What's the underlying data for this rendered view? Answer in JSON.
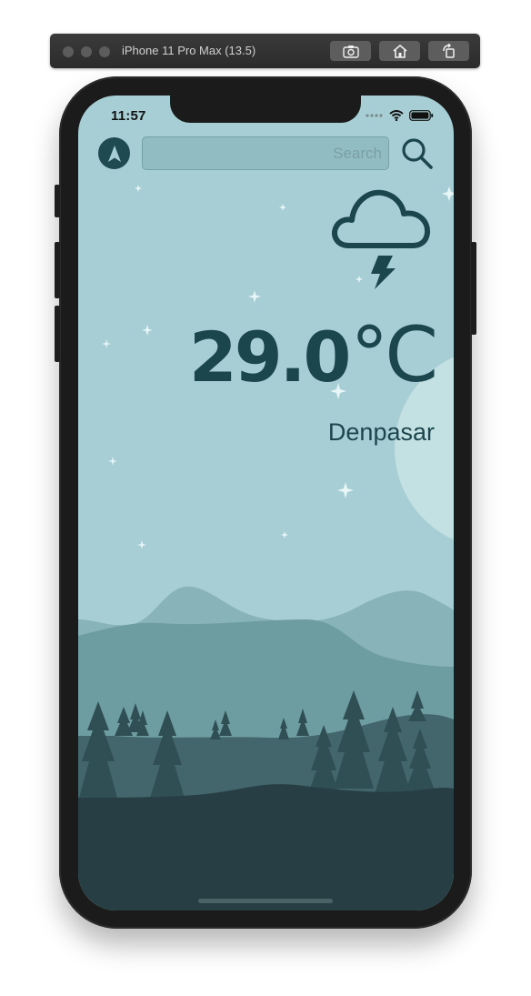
{
  "simulator": {
    "title": "iPhone 11 Pro Max (13.5)",
    "buttons": [
      "screenshot-icon",
      "home-icon",
      "rotate-icon"
    ]
  },
  "status_bar": {
    "time": "11:57",
    "icons": [
      "signal-dots-icon",
      "wifi-icon",
      "battery-icon"
    ]
  },
  "app": {
    "location_button_icon": "navigation-arrow-icon",
    "search": {
      "placeholder": "Search",
      "value": ""
    },
    "search_button_icon": "magnifier-icon",
    "weather_icon": "thunderstorm-cloud-icon",
    "temperature": "29.0",
    "unit": "°C",
    "city": "Denpasar"
  },
  "colors": {
    "sky": "#a7ced4",
    "primary_text": "#1c464d",
    "moon": "#c3e0e3"
  }
}
